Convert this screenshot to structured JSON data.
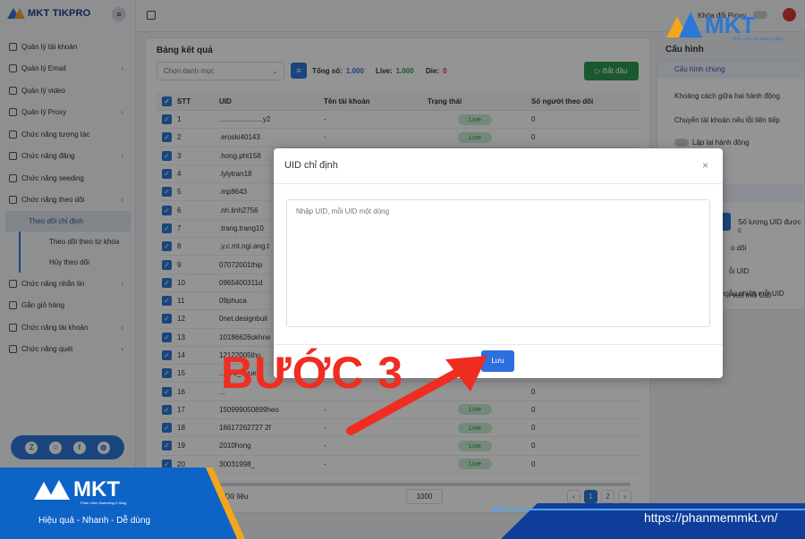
{
  "brand": {
    "name": "MKT TIKPRO"
  },
  "sidebar": {
    "items": [
      {
        "label": "Quản lý tài khoản",
        "chevron": false
      },
      {
        "label": "Quản lý Email",
        "chevron": true
      },
      {
        "label": "Quản lý video",
        "chevron": false
      },
      {
        "label": "Quản lý Proxy",
        "chevron": true
      },
      {
        "label": "Chức năng tương tác",
        "chevron": false
      },
      {
        "label": "Chức năng đăng",
        "chevron": true
      },
      {
        "label": "Chức năng seeding",
        "chevron": false
      },
      {
        "label": "Chức năng theo dõi",
        "chevron": true
      }
    ],
    "sub_items": [
      {
        "label": "Theo dõi chỉ định",
        "active": true
      },
      {
        "label": "Theo dõi theo từ khóa",
        "active": false
      },
      {
        "label": "Hủy theo dõi",
        "active": false
      }
    ],
    "items_after": [
      {
        "label": "Chức năng nhắn tin",
        "chevron": true
      },
      {
        "label": "Gắn giỏ hàng",
        "chevron": false
      },
      {
        "label": "Chức năng tài khoản",
        "chevron": true
      },
      {
        "label": "Chức năng quét",
        "chevron": true
      }
    ],
    "chevron_glyph": "›"
  },
  "topbar": {
    "proxy_label": "Khóa đổi Proxy"
  },
  "results": {
    "title": "Bảng kết quả",
    "category_placeholder": "Chọn danh mục",
    "total_label": "Tổng số:",
    "total_value": "1.000",
    "live_label": "Live:",
    "live_value": "1.000",
    "die_label": "Die:",
    "die_value": "0",
    "start_label": "Bắt đầu",
    "columns": [
      "STT",
      "UID",
      "Tên tài khoản",
      "Trạng thái",
      "Số người theo dõi"
    ],
    "rows": [
      {
        "stt": "1",
        "uid": "......................y2",
        "name": "-",
        "status": "Live",
        "followers": "0"
      },
      {
        "stt": "2",
        "uid": ".eroski40143",
        "name": "-",
        "status": "Live",
        "followers": "0"
      },
      {
        "stt": "3",
        "uid": ".hong.pht158",
        "name": "",
        "status": "",
        "followers": ""
      },
      {
        "stt": "4",
        "uid": ".lylytran18",
        "name": "",
        "status": "",
        "followers": ""
      },
      {
        "stt": "5",
        "uid": ".mp8643",
        "name": "",
        "status": "",
        "followers": ""
      },
      {
        "stt": "6",
        "uid": ".nh.linh2756",
        "name": "",
        "status": "",
        "followers": ""
      },
      {
        "stt": "7",
        "uid": ".trang.trang10",
        "name": "",
        "status": "",
        "followers": ""
      },
      {
        "stt": "8",
        "uid": ".y.c.mt.ngi.ang.t",
        "name": "",
        "status": "",
        "followers": ""
      },
      {
        "stt": "9",
        "uid": "07072001thip",
        "name": "",
        "status": "",
        "followers": ""
      },
      {
        "stt": "10",
        "uid": "0965400311d",
        "name": "",
        "status": "",
        "followers": ""
      },
      {
        "stt": "11",
        "uid": "09phuca",
        "name": "",
        "status": "",
        "followers": ""
      },
      {
        "stt": "12",
        "uid": "0net.designbuil",
        "name": "",
        "status": "",
        "followers": ""
      },
      {
        "stt": "13",
        "uid": "10186626okhne",
        "name": "",
        "status": "",
        "followers": ""
      },
      {
        "stt": "14",
        "uid": "12122005thu",
        "name": "",
        "status": "",
        "followers": ""
      },
      {
        "stt": "15",
        "uid": "...578_0vue",
        "name": "",
        "status": "",
        "followers": ""
      },
      {
        "stt": "16",
        "uid": "...",
        "name": "",
        "status": "",
        "followers": "0"
      },
      {
        "stt": "17",
        "uid": "150999050899heo",
        "name": "-",
        "status": "Live",
        "followers": "0"
      },
      {
        "stt": "18",
        "uid": "16617262727 2f",
        "name": "-",
        "status": "Live",
        "followers": "0"
      },
      {
        "stt": "19",
        "uid": "2010hong",
        "name": "-",
        "status": "Live",
        "followers": "0"
      },
      {
        "stt": "20",
        "uid": "30031998_",
        "name": "-",
        "status": "Live",
        "followers": "0"
      }
    ],
    "footer_text": "trong 1984 Dữ liệu",
    "page_size": "1000",
    "pages": [
      "‹",
      "1",
      "2",
      "›"
    ]
  },
  "config": {
    "title": "Cấu hình",
    "general_header": "Cấu hình chung",
    "lines": [
      "Khoảng cách giữa hai hành động",
      "Chuyển tài khoản nếu lỗi liên tiếp",
      "Lặp lại hành động"
    ],
    "sub_header": "dõi",
    "sub_lines": [
      "Số lượng UID được c",
      "o dõi",
      "ỗi UID",
      "i viết mỗi UID",
      "ngẫu nhiên mỗi UID"
    ]
  },
  "modal": {
    "title": "UID chỉ định",
    "close_glyph": "×",
    "textarea_placeholder": "Nhập UID, mỗi UID một dòng",
    "save_label": "Lưu"
  },
  "annotation": {
    "step_text": "BƯỚC 3",
    "color": "#ef2d20"
  },
  "banner": {
    "logo_text": "MKT",
    "logo_sub": "Phần mềm Marketing 0 đồng",
    "slogan": "Hiệu quả - Nhanh - Dễ dùng",
    "url": "https://phanmemmkt.vn/",
    "top_logo_text": "MKT",
    "top_logo_sub": "Phần mềm Marketing 0 đồng"
  },
  "colors": {
    "accent": "#2d77d6",
    "brand_orange": "#f2a51e",
    "success": "#2e9a50",
    "banner_blue": "#0e63c7"
  }
}
